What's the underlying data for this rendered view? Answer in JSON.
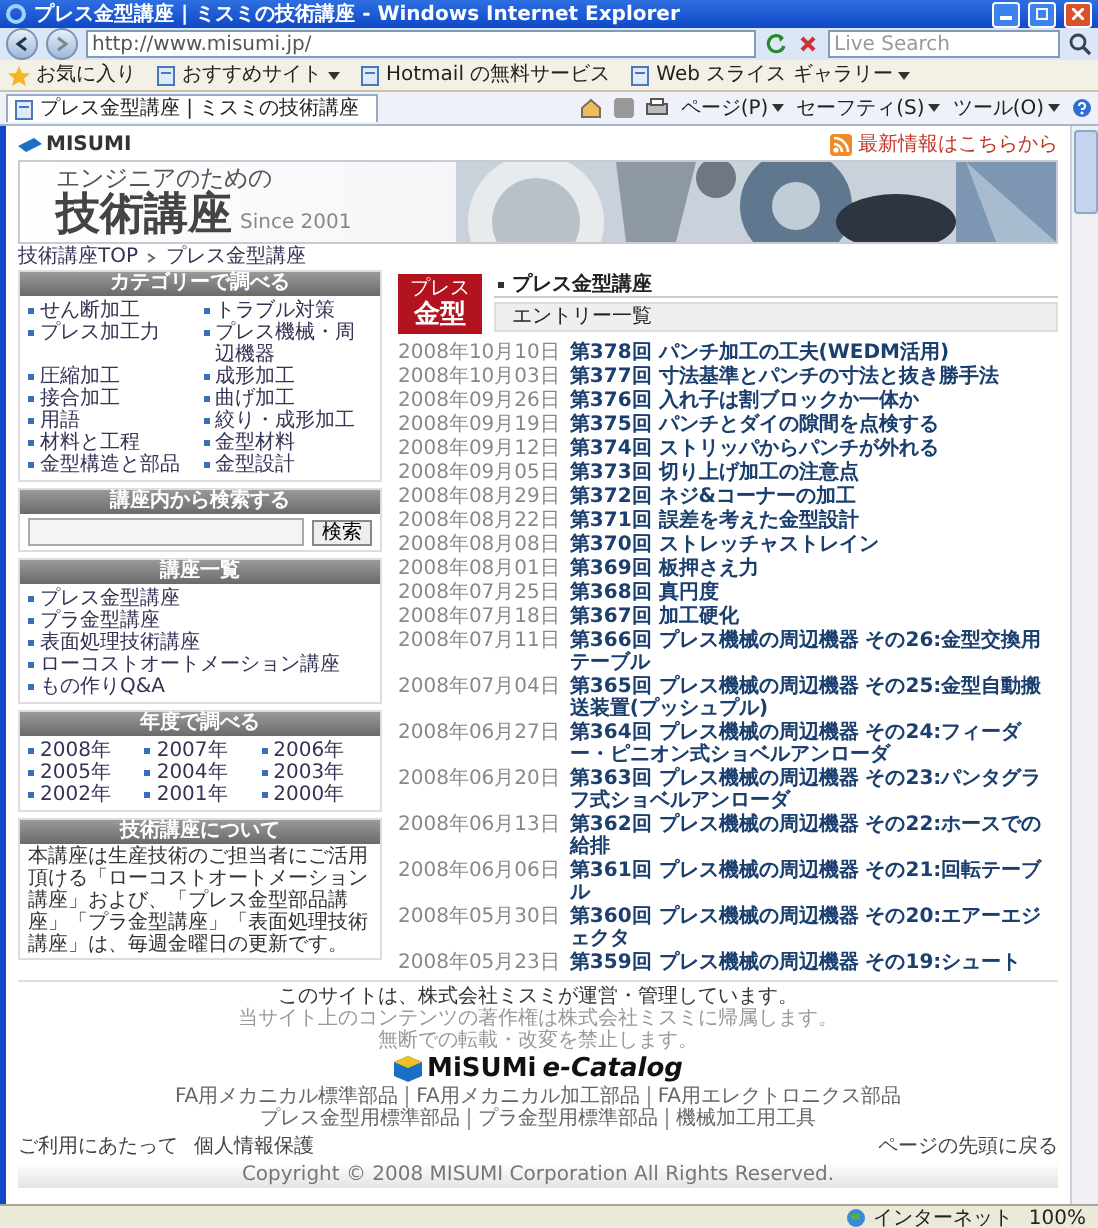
{
  "window": {
    "title": "プレス金型講座 | ミスミの技術講座 - Windows Internet Explorer"
  },
  "address_bar": {
    "url": "http://www.misumi.jp/",
    "search_placeholder": "Live Search"
  },
  "favorites_bar": {
    "items": [
      {
        "label": "お気に入り",
        "kind": "favorites"
      },
      {
        "label": "おすすめサイト",
        "kind": "menu"
      },
      {
        "label": "Hotmail の無料サービス",
        "kind": "link"
      },
      {
        "label": "Web スライス ギャラリー",
        "kind": "menu"
      }
    ]
  },
  "tab": {
    "title": "プレス金型講座 | ミスミの技術講座"
  },
  "command_bar": {
    "items": [
      "ページ(P)",
      "セーフティ(S)",
      "ツール(O)"
    ]
  },
  "page": {
    "header": {
      "logo": "MISUMI",
      "rss_link": "最新情報はこちらから"
    },
    "banner": {
      "subtitle": "エンジニアのための",
      "title": "技術講座",
      "since": "Since 2001"
    },
    "breadcrumb": [
      "技術講座TOP",
      "プレス金型講座"
    ],
    "sidebar": {
      "categories": {
        "heading": "カテゴリーで調べる",
        "items": [
          "せん断加工",
          "トラブル対策",
          "プレス加工力",
          "プレス機械・周辺機器",
          "圧縮加工",
          "成形加工",
          "接合加工",
          "曲げ加工",
          "用語",
          "絞り・成形加工",
          "材料と工程",
          "金型材料",
          "金型構造と部品",
          "金型設計"
        ]
      },
      "search": {
        "heading": "講座内から検索する",
        "button": "検索"
      },
      "courses": {
        "heading": "講座一覧",
        "items": [
          "プレス金型講座",
          "プラ金型講座",
          "表面処理技術講座",
          "ローコストオートメーション講座",
          "もの作りQ&A"
        ]
      },
      "years": {
        "heading": "年度で調べる",
        "items": [
          "2008年",
          "2007年",
          "2006年",
          "2005年",
          "2004年",
          "2003年",
          "2002年",
          "2001年",
          "2000年"
        ]
      },
      "about": {
        "heading": "技術講座について",
        "text": "本講座は生産技術のご担当者にご活用頂ける「ローコストオートメーション講座」および、「プレス金型部品講座」「プラ金型講座」「表面処理技術講座」は、毎週金曜日の更新です。"
      }
    },
    "main": {
      "badge": [
        "プレス",
        "金型"
      ],
      "title": "プレス金型講座",
      "section_label": "エントリー一覧",
      "entries": [
        {
          "date": "2008年10月10日",
          "title": "第378回 パンチ加工の工夫(WEDM活用)"
        },
        {
          "date": "2008年10月03日",
          "title": "第377回 寸法基準とパンチの寸法と抜き勝手法"
        },
        {
          "date": "2008年09月26日",
          "title": "第376回 入れ子は割ブロックか一体か"
        },
        {
          "date": "2008年09月19日",
          "title": "第375回 パンチとダイの隙間を点検する"
        },
        {
          "date": "2008年09月12日",
          "title": "第374回 ストリッパからパンチが外れる"
        },
        {
          "date": "2008年09月05日",
          "title": "第373回 切り上げ加工の注意点"
        },
        {
          "date": "2008年08月29日",
          "title": "第372回 ネジ&コーナーの加工"
        },
        {
          "date": "2008年08月22日",
          "title": "第371回 誤差を考えた金型設計"
        },
        {
          "date": "2008年08月08日",
          "title": "第370回 ストレッチャストレイン"
        },
        {
          "date": "2008年08月01日",
          "title": "第369回 板押さえ力"
        },
        {
          "date": "2008年07月25日",
          "title": "第368回 真円度"
        },
        {
          "date": "2008年07月18日",
          "title": "第367回 加工硬化"
        },
        {
          "date": "2008年07月11日",
          "title": "第366回 プレス機械の周辺機器 その26:金型交換用テーブル"
        },
        {
          "date": "2008年07月04日",
          "title": "第365回 プレス機械の周辺機器 その25:金型自動搬送装置(プッシュプル)"
        },
        {
          "date": "2008年06月27日",
          "title": "第364回 プレス機械の周辺機器 その24:フィーダー・ピニオン式ショベルアンローダ"
        },
        {
          "date": "2008年06月20日",
          "title": "第363回 プレス機械の周辺機器 その23:パンタグラフ式ショベルアンローダ"
        },
        {
          "date": "2008年06月13日",
          "title": "第362回 プレス機械の周辺機器 その22:ホースでの給排"
        },
        {
          "date": "2008年06月06日",
          "title": "第361回 プレス機械の周辺機器 その21:回転テーブル"
        },
        {
          "date": "2008年05月30日",
          "title": "第360回 プレス機械の周辺機器 その20:エアーエジェクタ"
        },
        {
          "date": "2008年05月23日",
          "title": "第359回 プレス機械の周辺機器 その19:シュート"
        }
      ]
    },
    "footer": {
      "notice": "このサイトは、株式会社ミスミが運営・管理しています。",
      "rights": [
        "当サイト上のコンテンツの著作権は株式会社ミスミに帰属します。",
        "無断での転載・改変を禁止します。"
      ],
      "catalog_logo": {
        "brand": "MiSUMi",
        "product": "e-Catalog"
      },
      "link_rows": [
        [
          "FA用メカニカル標準部品",
          "FA用メカニカル加工部品",
          "FA用エレクトロニクス部品"
        ],
        [
          "プレス金型用標準部品",
          "プラ金型用標準部品",
          "機械加工用工具"
        ]
      ],
      "bottom_links": [
        "ご利用にあたって",
        "個人情報保護"
      ],
      "back_to_top": "ページの先頭に戻る",
      "copyright": "Copyright © 2008 MISUMI Corporation All Rights Reserved."
    }
  },
  "status_bar": {
    "zone": "インターネット",
    "zoom": "100%"
  }
}
